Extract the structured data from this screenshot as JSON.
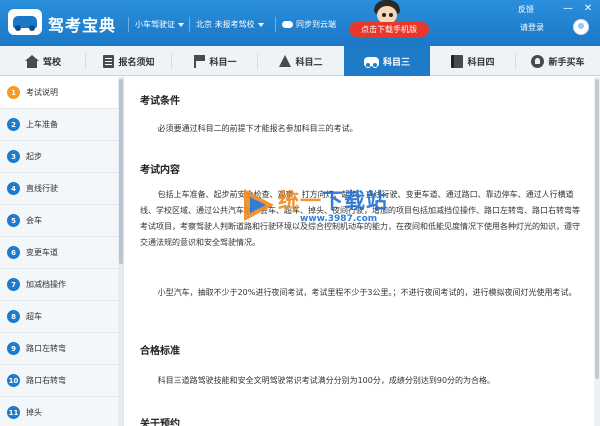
{
  "app": {
    "title": "驾考宝典",
    "license_selector": "小车驾驶证",
    "location_selector": "北京 未报考驾校",
    "sync_label": "同步到云端",
    "download_button": "点击下载手机版",
    "feedback_link": "反馈",
    "user_prompt": "请登录",
    "minimize_glyph": "—",
    "close_glyph": "✕"
  },
  "nav": {
    "tabs": [
      {
        "label": "驾校",
        "icon": "home-icon"
      },
      {
        "label": "报名须知",
        "icon": "document-icon"
      },
      {
        "label": "科目一",
        "icon": "flag-icon"
      },
      {
        "label": "科目二",
        "icon": "cone-icon"
      },
      {
        "label": "科目三",
        "icon": "car-icon",
        "active": true
      },
      {
        "label": "科目四",
        "icon": "book-icon"
      },
      {
        "label": "新手买车",
        "icon": "rocket-icon"
      }
    ]
  },
  "sidebar": {
    "items": [
      {
        "num": "1",
        "label": "考试说明",
        "active": true
      },
      {
        "num": "2",
        "label": "上车准备"
      },
      {
        "num": "3",
        "label": "起步"
      },
      {
        "num": "4",
        "label": "直线行驶"
      },
      {
        "num": "5",
        "label": "会车"
      },
      {
        "num": "6",
        "label": "变更车道"
      },
      {
        "num": "7",
        "label": "加减档操作"
      },
      {
        "num": "8",
        "label": "超车"
      },
      {
        "num": "9",
        "label": "路口左转弯"
      },
      {
        "num": "10",
        "label": "路口右转弯"
      },
      {
        "num": "11",
        "label": "掉头"
      }
    ]
  },
  "content": {
    "sections": [
      {
        "heading": "考试条件",
        "paragraphs": [
          "必须要通过科目二的前提下才能报名参加科目三的考试。"
        ]
      },
      {
        "heading": "考试内容",
        "paragraphs": [
          "包括上车准备、起步前安全检查、观察、打方向灯、起步、直线行驶、变更车道、通过路口、靠边停车、通过人行横道线、学校区域、通过公共汽车站、会车、超车、掉头、夜间行驶，增加的项目包括加减挡位操作、路口左转弯、路口右转弯等考试项目，考察驾驶人判断道路和行驶环境以及综合控制机动车的能力，在夜间和低能见度情况下使用各种灯光的知识，遵守交通法规的意识和安全驾驶情况。",
          "小型汽车，抽取不少于20%进行夜间考试，考试里程不少于3公里。；不进行夜间考试的，进行模拟夜间灯光使用考试。"
        ]
      },
      {
        "heading": "合格标准",
        "paragraphs": [
          "科目三道路驾驶技能和安全文明驾驶常识考试满分分别为100分，成绩分别达到90分的为合格。"
        ]
      },
      {
        "heading": "关于预约",
        "paragraphs": []
      }
    ]
  },
  "watermark": {
    "text_a": "统一",
    "text_b": "下载站",
    "sub": "www.3987.com"
  },
  "colors": {
    "titlebar": "#1b78c6",
    "accent": "#1f7ac8",
    "active_step": "#f39c1f",
    "download": "#e8382c"
  }
}
